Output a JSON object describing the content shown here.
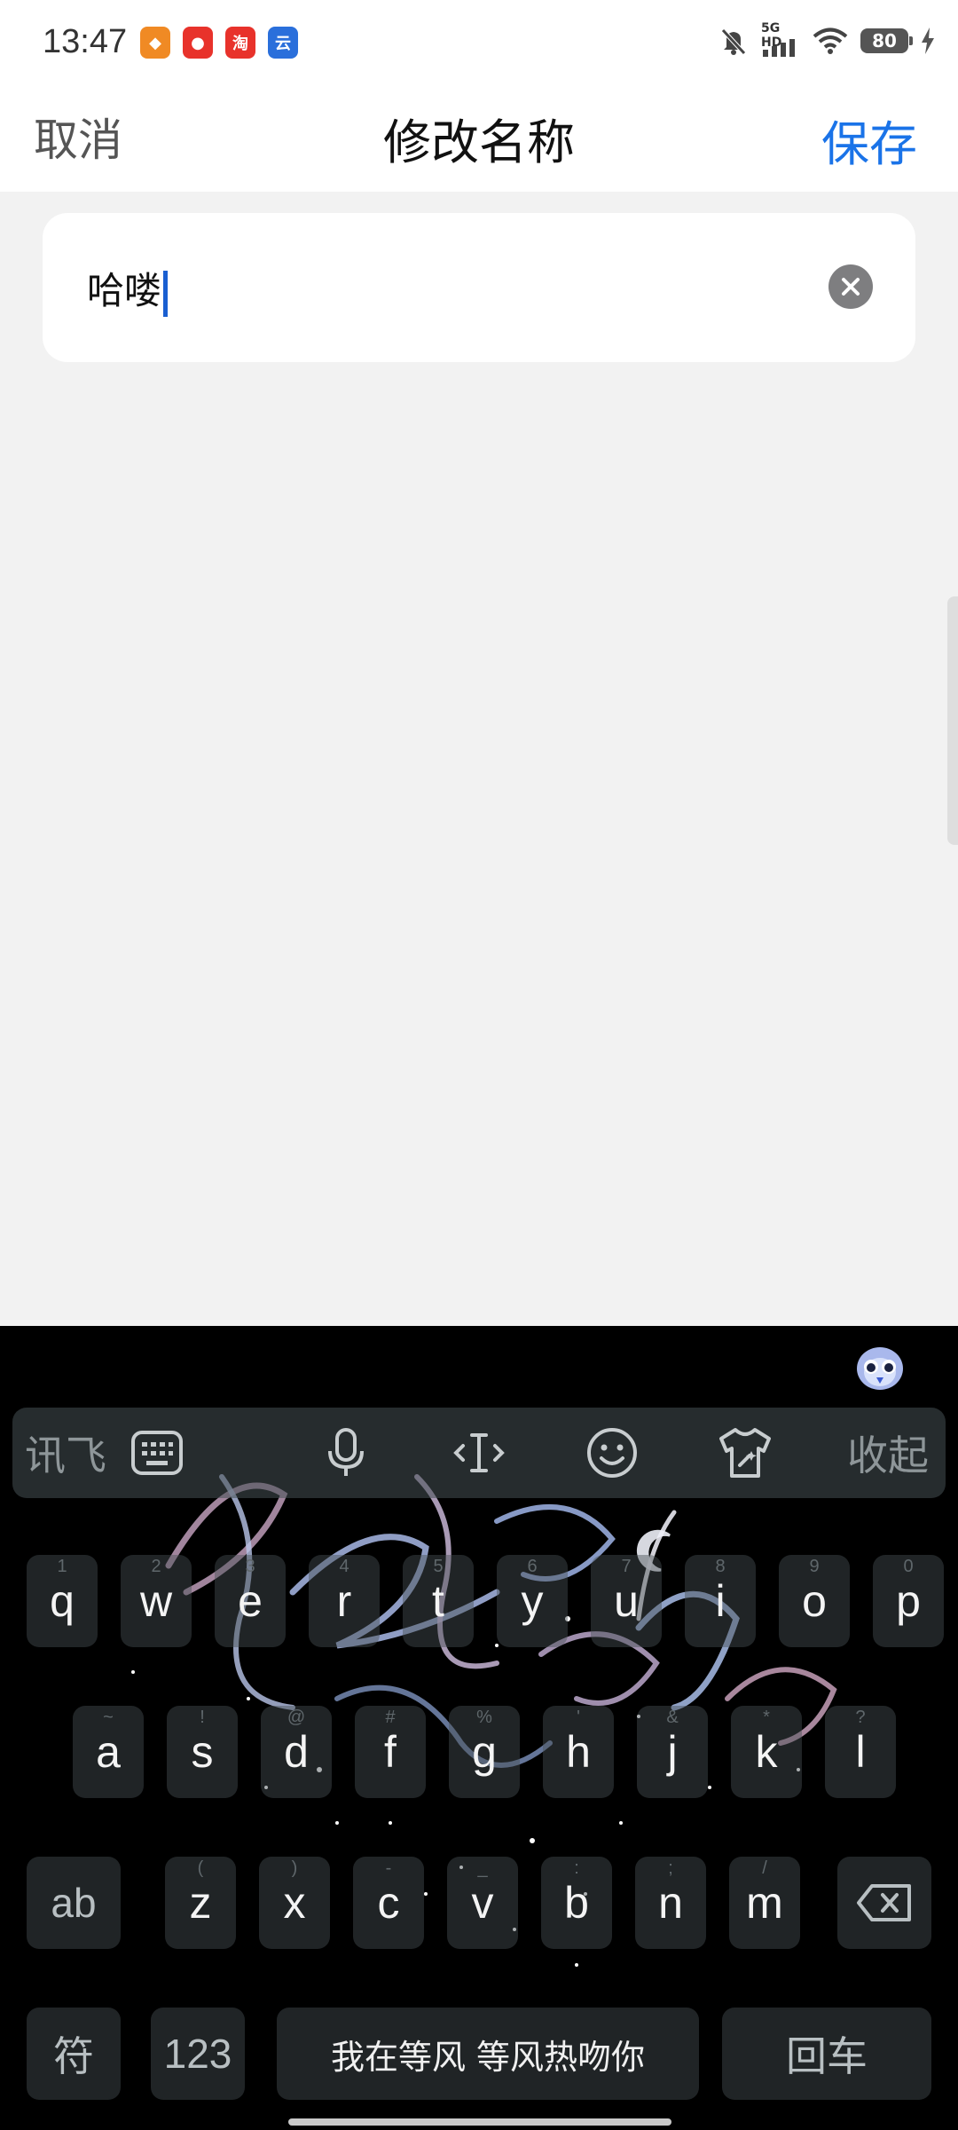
{
  "status_bar": {
    "time": "13:47",
    "app_icons": [
      {
        "name": "app-1-icon",
        "color": "#f08a24",
        "glyph": "◆"
      },
      {
        "name": "app-2-icon",
        "color": "#e8322b",
        "glyph": "●"
      },
      {
        "name": "taobao-icon",
        "color": "#e8322b",
        "glyph": "淘"
      },
      {
        "name": "app-4-icon",
        "color": "#2a6fdb",
        "glyph": "云"
      }
    ],
    "network": "5G HD",
    "battery": "80"
  },
  "header": {
    "cancel_label": "取消",
    "title": "修改名称",
    "save_label": "保存",
    "accent_color": "#1a73e8"
  },
  "name_input": {
    "value": "哈喽"
  },
  "keyboard": {
    "toolbar": {
      "brand_label": "讯飞",
      "collapse_label": "收起"
    },
    "row1": [
      {
        "letter": "q",
        "hint": "1"
      },
      {
        "letter": "w",
        "hint": "2"
      },
      {
        "letter": "e",
        "hint": "3"
      },
      {
        "letter": "r",
        "hint": "4"
      },
      {
        "letter": "t",
        "hint": "5"
      },
      {
        "letter": "y",
        "hint": "6"
      },
      {
        "letter": "u",
        "hint": "7"
      },
      {
        "letter": "i",
        "hint": "8"
      },
      {
        "letter": "o",
        "hint": "9"
      },
      {
        "letter": "p",
        "hint": "0"
      }
    ],
    "row2": [
      {
        "letter": "a",
        "hint": "~"
      },
      {
        "letter": "s",
        "hint": "!"
      },
      {
        "letter": "d",
        "hint": "@"
      },
      {
        "letter": "f",
        "hint": "#"
      },
      {
        "letter": "g",
        "hint": "%"
      },
      {
        "letter": "h",
        "hint": "'"
      },
      {
        "letter": "j",
        "hint": "&"
      },
      {
        "letter": "k",
        "hint": "*"
      },
      {
        "letter": "l",
        "hint": "?"
      }
    ],
    "row3": [
      {
        "letter": "z",
        "hint": "("
      },
      {
        "letter": "x",
        "hint": ")"
      },
      {
        "letter": "c",
        "hint": "-"
      },
      {
        "letter": "v",
        "hint": "_"
      },
      {
        "letter": "b",
        "hint": ":"
      },
      {
        "letter": "n",
        "hint": ";"
      },
      {
        "letter": "m",
        "hint": "/"
      }
    ],
    "shift_label": "ab",
    "symbol_label": "符",
    "number_label": "123",
    "space_label": "我在等风 等风热吻你",
    "enter_label": "回车"
  }
}
